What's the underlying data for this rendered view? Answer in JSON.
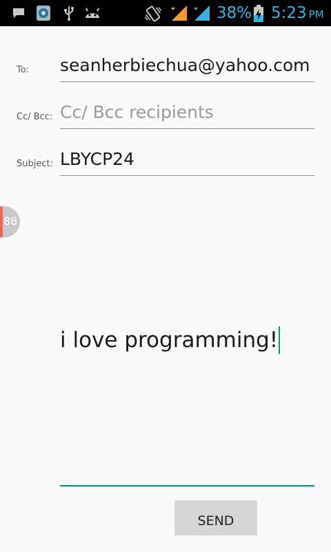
{
  "status_bar": {
    "battery_percent": "38%",
    "time": "5:23",
    "ampm": "PM",
    "icons": [
      "message-icon",
      "app-badge-icon",
      "usb-icon",
      "android-icon",
      "vibrate-icon",
      "signal-orange-icon",
      "signal-blue-icon",
      "battery-charging-icon"
    ],
    "colors": {
      "clock": "#33b5e5",
      "signal_1": "#f39c2a",
      "signal_2": "#33b5e5"
    }
  },
  "form": {
    "to_label": "To:",
    "to_value": "seanherbiechua@yahoo.com",
    "cc_label": "Cc/ Bcc:",
    "cc_placeholder": "Cc/ Bcc recipients",
    "subject_label": "Subject:",
    "subject_value": "LBYCP24",
    "message": "i love programming!"
  },
  "bubble": {
    "count": "88"
  },
  "actions": {
    "send_label": "SEND"
  },
  "colors": {
    "accent": "#009688",
    "background": "#fafafa"
  }
}
